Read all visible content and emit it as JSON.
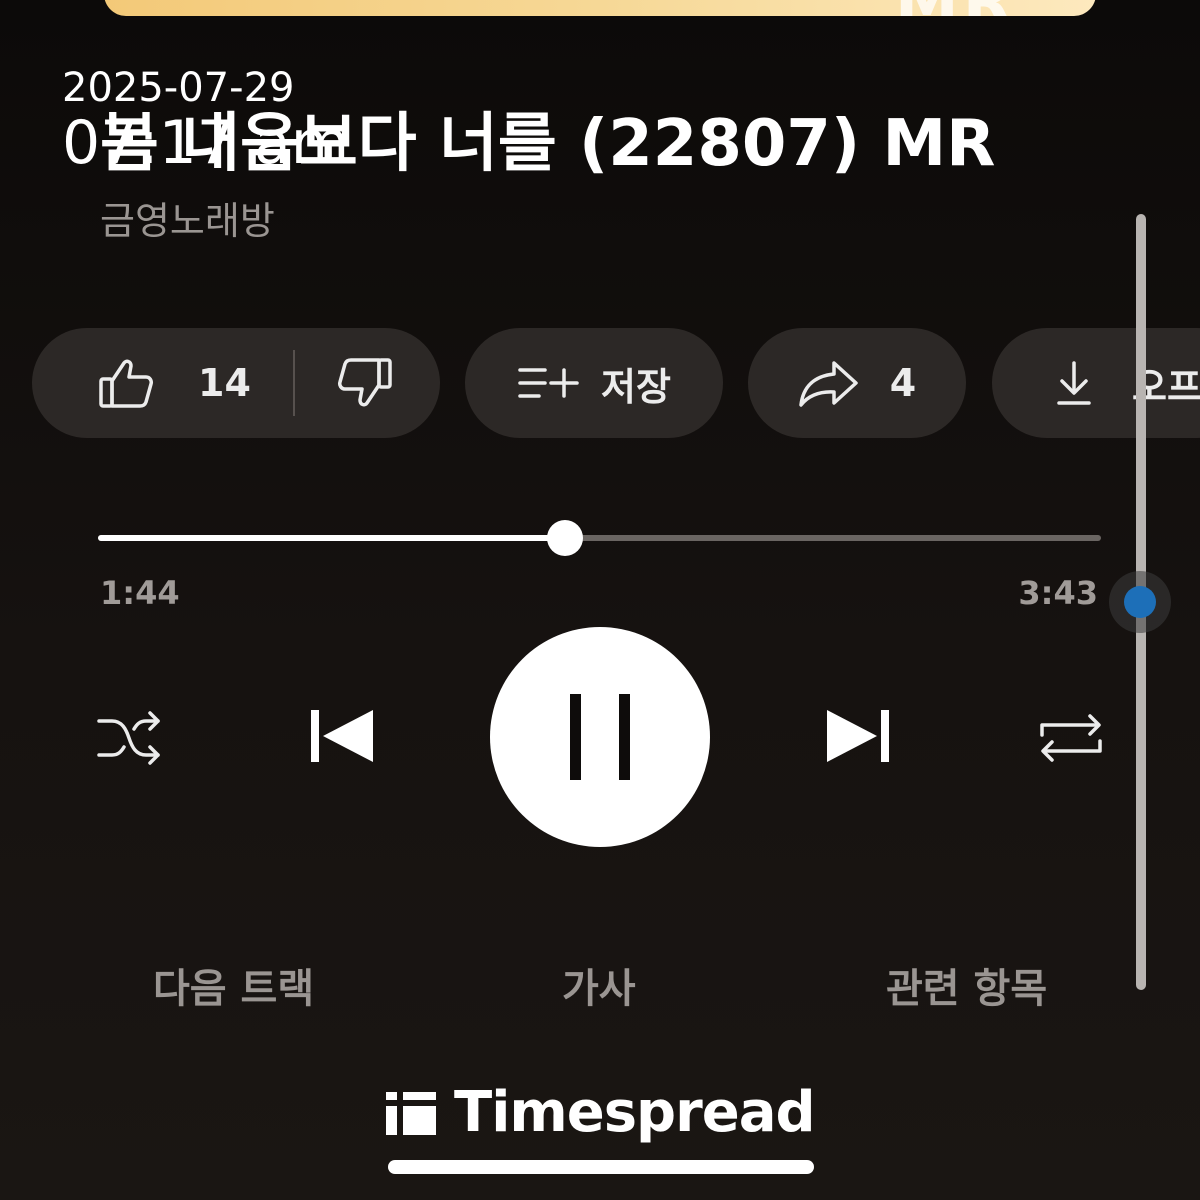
{
  "album_art": {
    "text": "MR"
  },
  "overlay": {
    "date": "2025-07-29",
    "time": "07:17 am"
  },
  "song": {
    "title": "봄 내음보다 너를 (22807) MR",
    "artist": "금영노래방"
  },
  "actions": {
    "like_count": "14",
    "save_label": "저장",
    "share_count": "4",
    "download_label": "오프"
  },
  "playback": {
    "elapsed": "1:44",
    "total": "3:43",
    "progress_fraction": 0.466
  },
  "tabs": [
    {
      "label": "다음 트랙"
    },
    {
      "label": "가사"
    },
    {
      "label": "관련 항목"
    }
  ],
  "watermark": {
    "brand": "Timespread"
  },
  "icons": {
    "like": "thumbs-up-icon",
    "dislike": "thumbs-down-icon",
    "save": "playlist-add-icon",
    "share": "share-arrow-icon",
    "download": "download-icon",
    "shuffle": "shuffle-icon",
    "previous": "skip-previous-icon",
    "pause": "pause-icon",
    "next": "skip-next-icon",
    "repeat": "repeat-icon"
  },
  "colors": {
    "background": "#14110f",
    "pill": "#2c2826",
    "accent_blue": "#1d6fb8",
    "album_gold": "#f3c978"
  }
}
